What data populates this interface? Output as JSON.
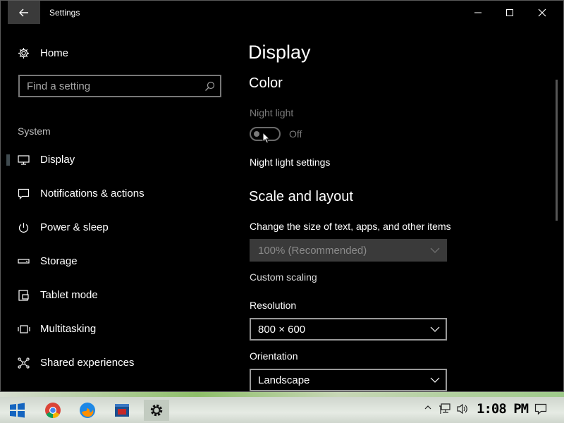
{
  "window": {
    "title": "Settings"
  },
  "sidebar": {
    "home_label": "Home",
    "search_placeholder": "Find a setting",
    "section_label": "System",
    "items": [
      {
        "label": "Display",
        "icon": "monitor-icon",
        "selected": true
      },
      {
        "label": "Notifications & actions",
        "icon": "message-icon"
      },
      {
        "label": "Power & sleep",
        "icon": "power-icon"
      },
      {
        "label": "Storage",
        "icon": "storage-icon"
      },
      {
        "label": "Tablet mode",
        "icon": "tablet-icon"
      },
      {
        "label": "Multitasking",
        "icon": "multitasking-icon"
      },
      {
        "label": "Shared experiences",
        "icon": "shared-icon"
      }
    ]
  },
  "main": {
    "title": "Display",
    "color": {
      "heading": "Color",
      "night_light_label": "Night light",
      "toggle_state": "Off",
      "night_light_settings_link": "Night light settings"
    },
    "scale": {
      "heading": "Scale and layout",
      "size_label": "Change the size of text, apps, and other items",
      "size_value": "100% (Recommended)",
      "custom_scaling_link": "Custom scaling",
      "resolution_label": "Resolution",
      "resolution_value": "800 × 600",
      "orientation_label": "Orientation",
      "orientation_value": "Landscape"
    }
  },
  "taskbar": {
    "time": "1:08 PM",
    "apps": [
      "start-icon",
      "chrome-icon",
      "firefox-icon",
      "app-icon",
      "settings-icon"
    ]
  },
  "colors": {
    "background": "#000000",
    "text": "#ffffff",
    "disabled": "#7a7a7a"
  }
}
